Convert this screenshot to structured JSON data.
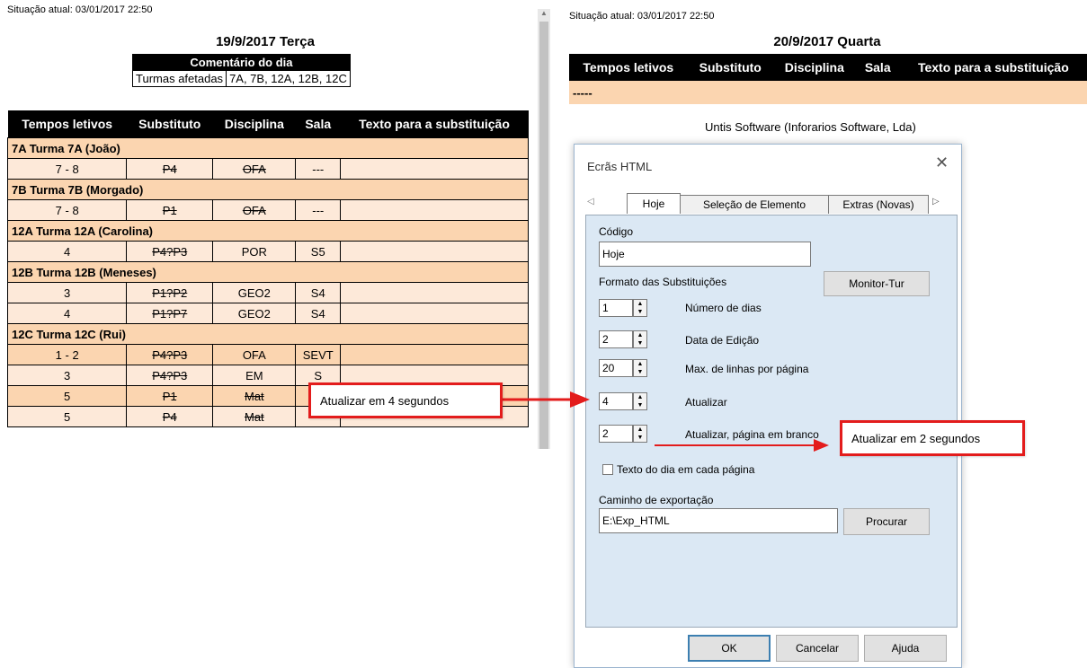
{
  "left_page": {
    "status": "Situação atual: 03/01/2017 22:50",
    "day_title": "19/9/2017 Terça",
    "comment_header": "Comentário do dia",
    "affected_label": "Turmas afetadas",
    "affected_value": "7A, 7B, 12A, 12B, 12C",
    "columns": [
      "Tempos letivos",
      "Substituto",
      "Disciplina",
      "Sala",
      "Texto para a substituição"
    ],
    "groups": [
      {
        "title": "7A Turma 7A (João)",
        "rows": [
          {
            "time": "7 - 8",
            "sub": "P4",
            "disc": "OFA",
            "sala": "---",
            "text": "",
            "sub_strike": true,
            "disc_strike": true
          }
        ]
      },
      {
        "title": "7B Turma 7B (Morgado)",
        "rows": [
          {
            "time": "7 - 8",
            "sub": "P1",
            "disc": "OFA",
            "sala": "---",
            "text": "",
            "sub_strike": true,
            "disc_strike": true
          }
        ]
      },
      {
        "title": "12A Turma 12A (Carolina)",
        "rows": [
          {
            "time": "4",
            "sub": "P4?P3",
            "disc": "POR",
            "sala": "S5",
            "text": "",
            "sub_strike": true,
            "disc_strike": false
          }
        ]
      },
      {
        "title": "12B Turma 12B (Meneses)",
        "rows": [
          {
            "time": "3",
            "sub": "P1?P2",
            "disc": "GEO2",
            "sala": "S4",
            "text": "",
            "sub_strike": true,
            "disc_strike": false
          },
          {
            "time": "4",
            "sub": "P1?P7",
            "disc": "GEO2",
            "sala": "S4",
            "text": "",
            "sub_strike": true,
            "disc_strike": false
          }
        ]
      },
      {
        "title": "12C Turma 12C (Rui)",
        "rows": [
          {
            "time": "1 - 2",
            "sub": "P4?P3",
            "disc": "OFA",
            "sala": "SEVT",
            "text": "",
            "sub_strike": true,
            "disc_strike": false
          },
          {
            "time": "3",
            "sub": "P4?P3",
            "disc": "EM",
            "sala": "S",
            "text": "",
            "sub_strike": true,
            "disc_strike": false
          },
          {
            "time": "5",
            "sub": "P1",
            "disc": "Mat",
            "sala": "-",
            "text": "",
            "sub_strike": true,
            "disc_strike": true
          },
          {
            "time": "5",
            "sub": "P4",
            "disc": "Mat",
            "sala": "---",
            "text": "",
            "sub_strike": true,
            "disc_strike": true
          }
        ]
      }
    ]
  },
  "right_page": {
    "status": "Situação atual: 03/01/2017 22:50",
    "day_title": "20/9/2017 Quarta",
    "columns": [
      "Tempos letivos",
      "Substituto",
      "Disciplina",
      "Sala",
      "Texto para a substituição"
    ],
    "empty_row": "-----",
    "footer": "Untis Software (Inforarios Software, Lda)"
  },
  "callouts": {
    "left": "Atualizar em 4 segundos",
    "right": "Atualizar em 2 segundos"
  },
  "colors": {
    "accent_red": "#e31c1c",
    "group_bg": "#fbd5b0",
    "row_light": "#fde9d9"
  },
  "dialog": {
    "title": "Ecrãs HTML",
    "close_icon": "close-icon",
    "tabs": [
      "Hoje",
      "Seleção de Elemento",
      "Extras (Novas)"
    ],
    "codigo_label": "Código",
    "codigo_value": "Hoje",
    "formato_label": "Formato das Substituições",
    "monitor_button": "Monitor-Tur",
    "fields": [
      {
        "value": "1",
        "label": "Número de dias"
      },
      {
        "value": "2",
        "label": "Data de Edição"
      },
      {
        "value": "20",
        "label": "Max. de linhas por página"
      },
      {
        "value": "4",
        "label": "Atualizar"
      },
      {
        "value": "2",
        "label": "Atualizar, página em branco"
      }
    ],
    "checkbox_label": "Texto do dia em cada página",
    "caminho_label": "Caminho de exportação",
    "caminho_value": "E:\\Exp_HTML",
    "procurar_button": "Procurar",
    "ok_button": "OK",
    "cancel_button": "Cancelar",
    "help_button": "Ajuda"
  }
}
